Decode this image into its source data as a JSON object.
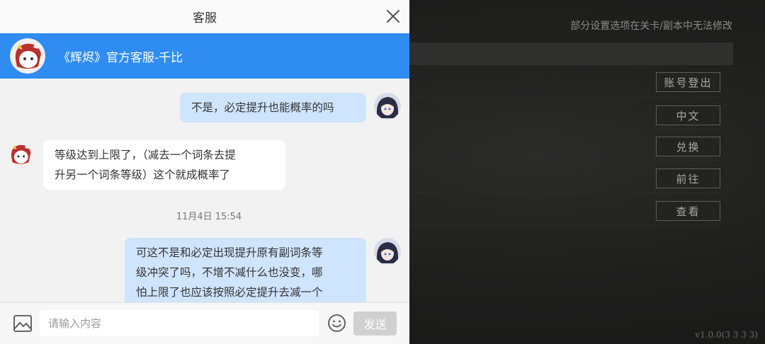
{
  "chat": {
    "title": "客服",
    "agent_name": "《辉烬》官方客服-千比",
    "messages": [
      {
        "from": "user",
        "lines": [
          "不是，必定提升也能概率的吗"
        ]
      },
      {
        "from": "agent",
        "lines": [
          "等级达到上限了，（减去一个词条去提",
          "升另一个词条等级）这个就成概率了"
        ]
      },
      {
        "timestamp": "11月4日 15:54"
      },
      {
        "from": "user",
        "lines": [
          "可这不是和必定出现提升原有副词条等",
          "级冲突了吗，不增不减什么也没变，哪",
          "怕上限了也应该按照必定提升去减一个"
        ]
      }
    ],
    "input_placeholder": "请输入内容",
    "send_label": "发送",
    "accent": "#2f8cf0",
    "user_bubble_color": "#cfe4fd"
  },
  "game": {
    "note": "部分设置选项在关卡/副本中无法修改",
    "buttons": [
      "账号登出",
      "中文",
      "兑换",
      "前往",
      "查看"
    ],
    "version": "v1.0.0(3 3 3 3)"
  }
}
